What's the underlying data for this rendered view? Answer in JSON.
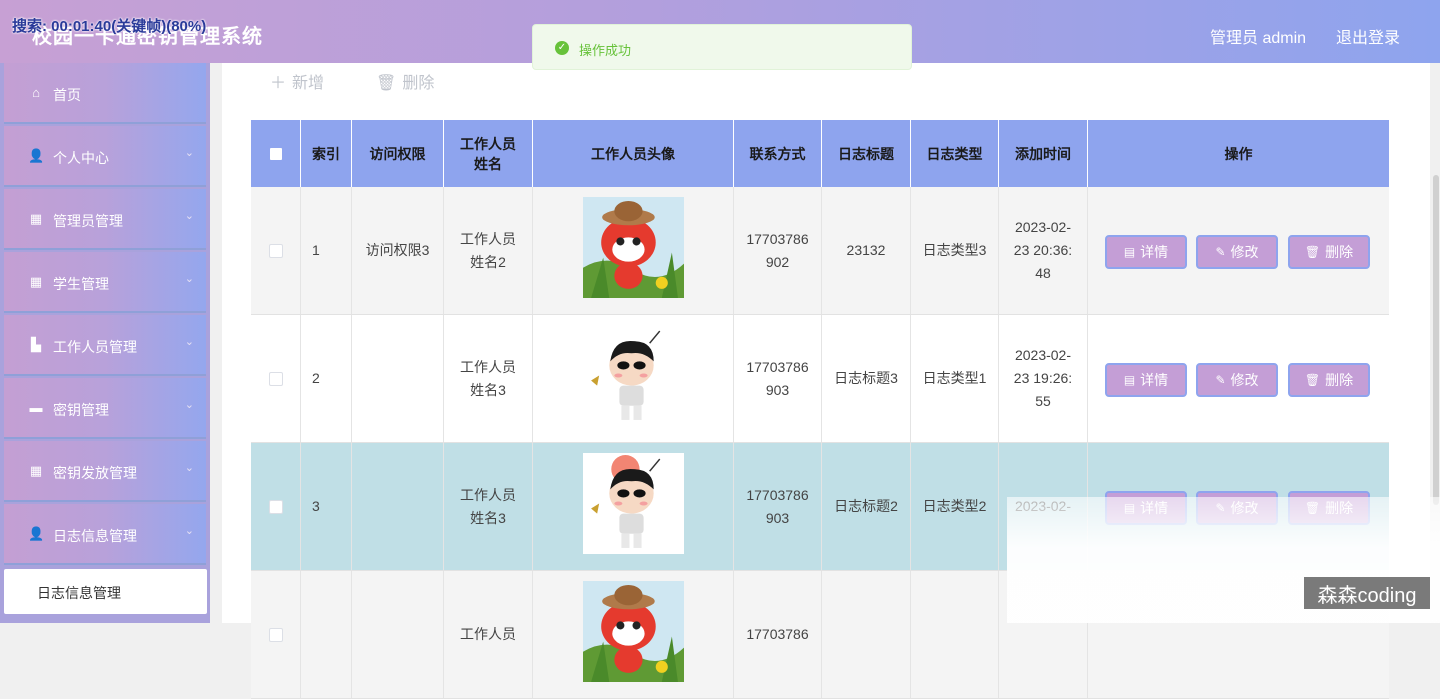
{
  "header": {
    "system_title": "校园一卡通密钥管理系统",
    "search_overlay": "搜索: 00:01:40(关键帧)(80%)",
    "admin_label": "管理员 admin",
    "logout_label": "退出登录"
  },
  "toast": {
    "text": "操作成功",
    "icon": "check-circle-icon",
    "color": "#67c23a"
  },
  "sidebar": {
    "items": [
      {
        "label": "首页",
        "icon": "home-icon",
        "glyph": "⌂",
        "chevron": false
      },
      {
        "label": "个人中心",
        "icon": "user-icon",
        "glyph": "👤",
        "chevron": true
      },
      {
        "label": "管理员管理",
        "icon": "grid-icon",
        "glyph": "▦",
        "chevron": true
      },
      {
        "label": "学生管理",
        "icon": "apps-icon",
        "glyph": "▦",
        "chevron": true
      },
      {
        "label": "工作人员管理",
        "icon": "thumb-icon",
        "glyph": "▙",
        "chevron": true
      },
      {
        "label": "密钥管理",
        "icon": "camera-icon",
        "glyph": "▬",
        "chevron": true
      },
      {
        "label": "密钥发放管理",
        "icon": "grid-icon",
        "glyph": "▦",
        "chevron": true
      },
      {
        "label": "日志信息管理",
        "icon": "user-icon",
        "glyph": "👤",
        "chevron": true
      }
    ],
    "submenu": {
      "label": "日志信息管理"
    }
  },
  "toolbar": {
    "add_label": "新增",
    "delete_label": "删除"
  },
  "table": {
    "headers": [
      "",
      "索引",
      "访问权限",
      "工作人员姓名",
      "工作人员头像",
      "联系方式",
      "日志标题",
      "日志类型",
      "添加时间",
      "操作"
    ],
    "header_lines": {
      "name": [
        "工作人员",
        "姓名"
      ]
    },
    "rows": [
      {
        "index": "1",
        "permission": "访问权限3",
        "name": [
          "工作人员",
          "姓名2"
        ],
        "avatar": "red-raccoon-avatar",
        "phone": [
          "17703786",
          "902"
        ],
        "title": "23132",
        "type": "日志类型3",
        "time": [
          "2023-02-",
          "23 20:36:",
          "48"
        ]
      },
      {
        "index": "2",
        "permission": "",
        "name": [
          "工作人员",
          "姓名3"
        ],
        "avatar": "cartoon-boy-avatar",
        "phone": [
          "17703786",
          "903"
        ],
        "title": "日志标题3",
        "type": "日志类型1",
        "time": [
          "2023-02-",
          "23 19:26:",
          "55"
        ]
      },
      {
        "index": "3",
        "permission": "",
        "name": [
          "工作人员",
          "姓名3"
        ],
        "avatar": "cartoon-boy-avatar",
        "phone": [
          "17703786",
          "903"
        ],
        "title": "日志标题2",
        "type": "日志类型2",
        "time": [
          "2023-02-",
          "",
          ""
        ]
      },
      {
        "index": "",
        "permission": "",
        "name": [
          "工作人员",
          ""
        ],
        "avatar": "red-raccoon-avatar",
        "phone": [
          "17703786",
          ""
        ],
        "title": "",
        "type": "",
        "time": [
          "",
          "",
          ""
        ]
      }
    ],
    "actions": {
      "detail": "详情",
      "edit": "修改",
      "delete": "删除"
    }
  },
  "watermark": "森森coding",
  "colors": {
    "header_start": "#c7a0d4",
    "header_end": "#8ea4ee",
    "table_header": "#8ea4ee",
    "button": "#c49ed6",
    "highlight_row": "#c0dfe6"
  }
}
